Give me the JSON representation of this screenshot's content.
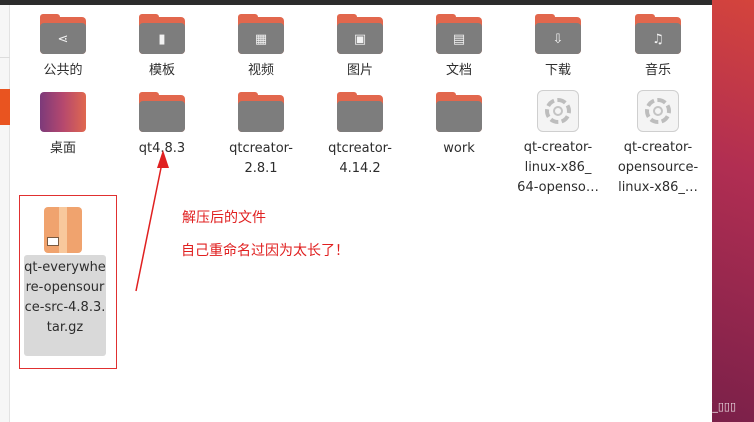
{
  "rows": [
    {
      "items": [
        {
          "name": "folder-public",
          "label": "公共的",
          "icon": "share-icon",
          "glyph": "⋖"
        },
        {
          "name": "folder-templates",
          "label": "模板",
          "icon": "template-icon",
          "glyph": "▮"
        },
        {
          "name": "folder-videos",
          "label": "视频",
          "icon": "film-icon",
          "glyph": "▦"
        },
        {
          "name": "folder-pictures",
          "label": "图片",
          "icon": "image-icon",
          "glyph": "▣"
        },
        {
          "name": "folder-documents",
          "label": "文档",
          "icon": "document-icon",
          "glyph": "▤"
        },
        {
          "name": "folder-downloads",
          "label": "下载",
          "icon": "download-icon",
          "glyph": "⇩"
        },
        {
          "name": "folder-music",
          "label": "音乐",
          "icon": "music-icon",
          "glyph": "♫"
        }
      ]
    },
    {
      "items": [
        {
          "name": "desktop-folder",
          "label": "桌面"
        },
        {
          "name": "folder-qt483",
          "label": "qt4.8.3"
        },
        {
          "name": "folder-qtcreator-281",
          "label": "qtcreator-\n2.8.1"
        },
        {
          "name": "folder-qtcreator-4142",
          "label": "qtcreator-\n4.14.2"
        },
        {
          "name": "folder-work",
          "label": "work"
        },
        {
          "name": "file-qt-creator-linux-x86-64",
          "label": "qt-creator-\nlinux-x86_\n64-openso…"
        },
        {
          "name": "file-qt-creator-opensource-linux",
          "label": "qt-creator-\nopensource-\nlinux-x86_…"
        }
      ]
    }
  ],
  "archive": {
    "label": "qt-everywhere-opensource-src-4.8.3.tar.gz"
  },
  "annotations": {
    "line1": "解压后的文件",
    "line2": "自己重命名过因为太长了！"
  },
  "watermark": "CSDN @AUV_▯▯▯",
  "colors": {
    "folder_tab": "#e2674d",
    "folder_body": "#7d7d7d",
    "annotation": "#e02020",
    "accent": "#e95420"
  }
}
